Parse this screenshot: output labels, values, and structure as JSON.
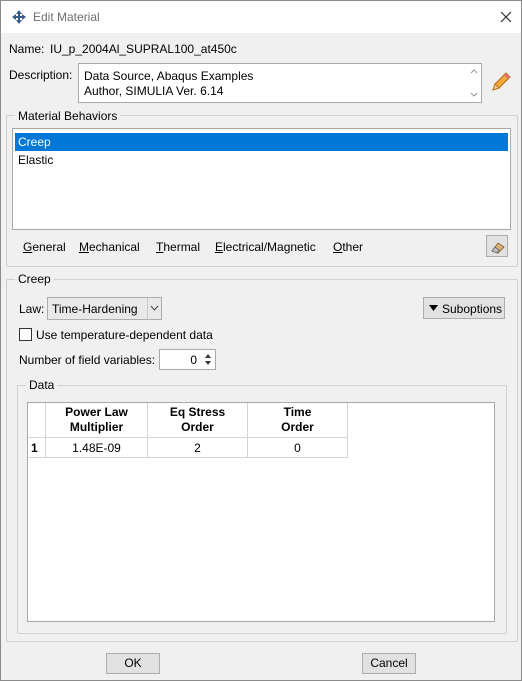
{
  "window": {
    "title": "Edit Material",
    "close_icon": "close-icon",
    "app_icon": "abaqus-app-icon"
  },
  "material": {
    "name_label": "Name:",
    "name_value": "IU_p_2004Al_SUPRAL100_at450c",
    "description_label": "Description:",
    "description_lines": [
      "Data Source,  Abaqus Examples",
      "Author, SIMULIA Ver. 6.14"
    ],
    "edit_icon": "pencil-icon"
  },
  "behaviors": {
    "title": "Material Behaviors",
    "items": [
      {
        "label": "Creep",
        "selected": true
      },
      {
        "label": "Elastic",
        "selected": false
      }
    ]
  },
  "menu": {
    "items": [
      {
        "underline": "G",
        "rest": "eneral"
      },
      {
        "underline": "M",
        "rest": "echanical"
      },
      {
        "underline": "T",
        "rest": "hermal"
      },
      {
        "underline": "E",
        "rest": "lectrical/Magnetic"
      },
      {
        "underline": "O",
        "rest": "ther"
      }
    ],
    "delete_icon": "eraser-icon"
  },
  "creep": {
    "title": "Creep",
    "law_label": "Law:",
    "law_value": "Time-Hardening",
    "suboptions_label": "Suboptions",
    "temp_dependent_label": "Use temperature-dependent data",
    "temp_dependent_checked": false,
    "field_vars_label": "Number of field variables:",
    "field_vars_value": "0",
    "data_title": "Data",
    "columns": [
      {
        "line1": "Power Law",
        "line2": "Multiplier"
      },
      {
        "line1": "Eq Stress",
        "line2": "Order"
      },
      {
        "line1": "Time",
        "line2": "Order"
      }
    ],
    "rows": [
      {
        "index": "1",
        "cells": [
          "1.48E-09",
          "2",
          "0"
        ]
      }
    ]
  },
  "footer": {
    "ok_label": "OK",
    "cancel_label": "Cancel"
  },
  "colors": {
    "selection": "#0078d7",
    "button_face": "#e1e1e1",
    "window_bg": "#f0f0f0"
  }
}
